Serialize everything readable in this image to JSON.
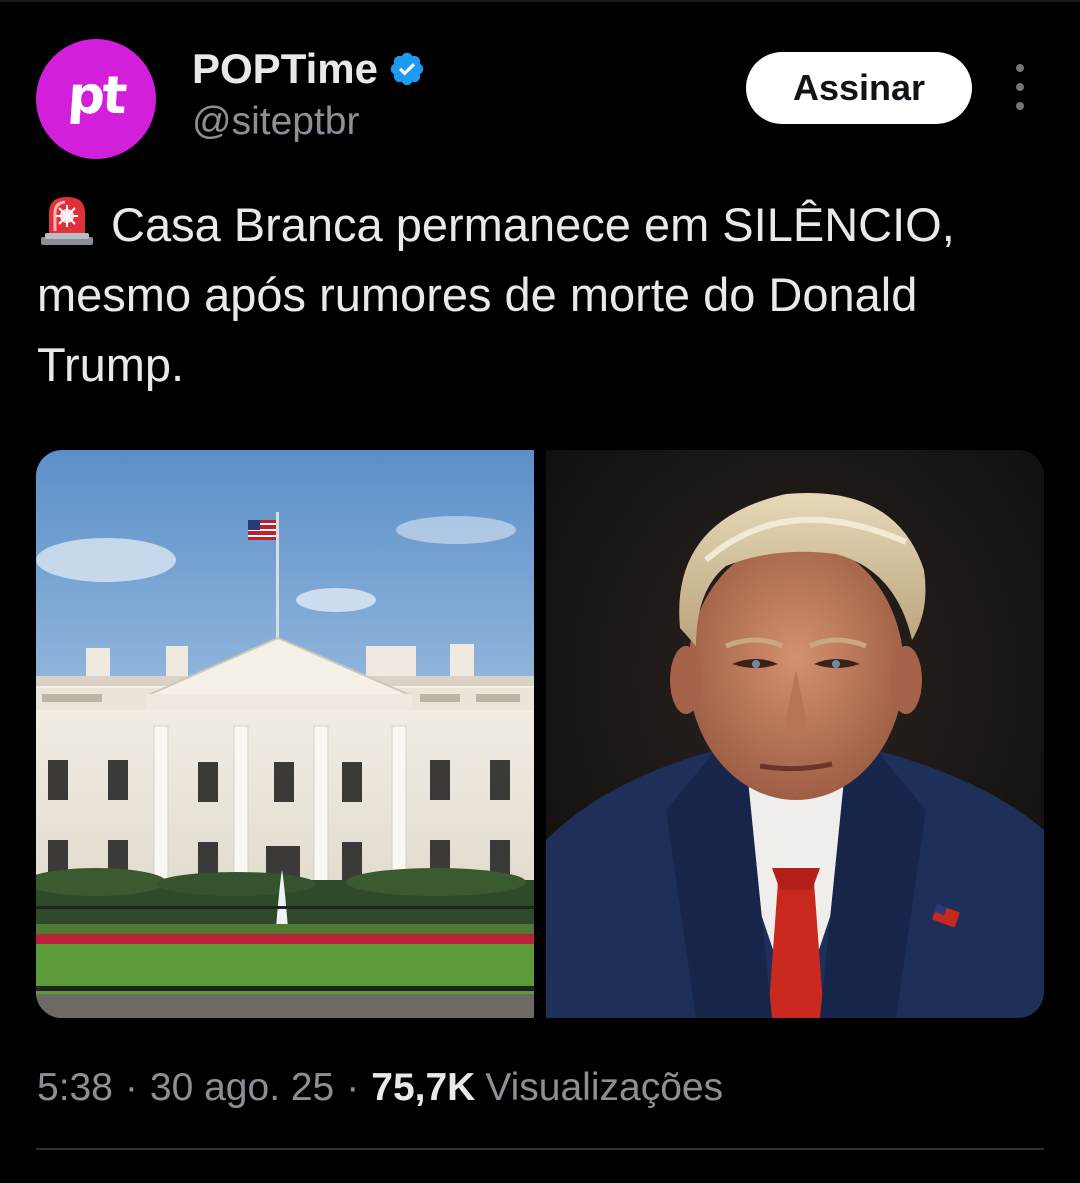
{
  "author": {
    "avatar_text": "pt",
    "display_name": "POPTime",
    "handle": "@siteptbr",
    "verified": true
  },
  "actions": {
    "subscribe_label": "Assinar",
    "more_icon": "more-vertical-icon"
  },
  "tweet": {
    "siren_icon": "police-siren-emoji",
    "text": "Casa Branca permanece em SILÊNCIO, mesmo após rumores de morte do Donald Trump."
  },
  "media": [
    {
      "subject": "white-house-photo"
    },
    {
      "subject": "portrait-photo"
    }
  ],
  "meta": {
    "time": "5:38",
    "date": "30 ago. 25",
    "views_count": "75,7K",
    "views_label": "Visualizações",
    "separator": "·"
  },
  "colors": {
    "background": "#000000",
    "text_primary": "#e7e9ea",
    "text_secondary": "#8b9096",
    "avatar_bg": "#d21fd9",
    "verified_blue": "#1d9bf0",
    "button_bg": "#ffffff"
  }
}
